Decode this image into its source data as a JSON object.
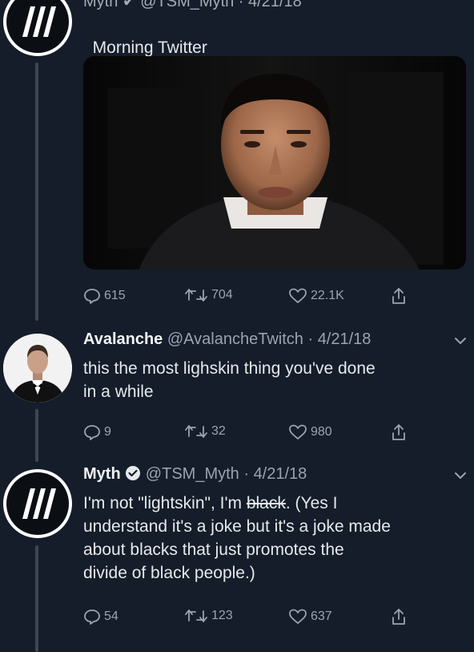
{
  "tweets": {
    "top": {
      "header_partial": "Myth ✔ @TSM_Myth · 4/21/18",
      "text": "Morning Twitter",
      "emoji": "❤️",
      "stats": {
        "replies": "615",
        "retweets": "704",
        "likes": "22.1K"
      }
    },
    "reply1": {
      "name": "Avalanche",
      "handle": "@AvalancheTwitch",
      "date": "4/21/18",
      "text": "this the most lighskin thing you've done\nin a while",
      "stats": {
        "replies": "9",
        "retweets": "32",
        "likes": "980"
      }
    },
    "reply2": {
      "name": "Myth",
      "handle": "@TSM_Myth",
      "date": "4/21/18",
      "text_before": "I'm not \"lightskin\", I'm ",
      "text_struck": "black",
      "text_after": ". (Yes I\nunderstand it's a joke but it's a joke made\nabout blacks that just promotes the\ndivide of black people.)",
      "stats": {
        "replies": "54",
        "retweets": "123",
        "likes": "637"
      }
    }
  },
  "icons": {
    "reply": "reply-icon",
    "retweet": "retweet-icon",
    "like": "like-icon",
    "share": "share-icon",
    "verified": "verified-icon",
    "chevron": "chevron-down-icon"
  },
  "colors": {
    "background": "#141d29",
    "thread_line": "#3b4755",
    "muted": "#9aa4af",
    "heart": "#e8364b"
  }
}
